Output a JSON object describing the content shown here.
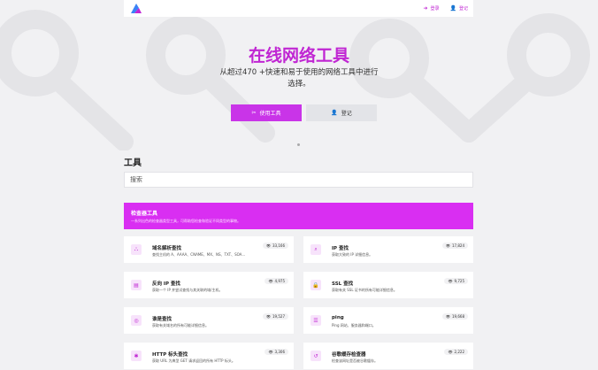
{
  "nav": {
    "login_label": "登录",
    "register_label": "登记"
  },
  "hero": {
    "title": "在线网络工具",
    "subtitle": "从超过470 +快速和易于使用的网络工具中进行选择。",
    "primary_button": "使用工具",
    "secondary_button": "登记"
  },
  "tools": {
    "heading": "工具",
    "search_placeholder": "搜索"
  },
  "category": {
    "title": "检查器工具",
    "description": "一系列出色的检查器类型工具，可帮助您检查和验证不同类型的事物。"
  },
  "cards": [
    {
      "title": "域名解析查找",
      "desc": "查找主机的 A、AAAA、CNAME、MX、NS、TXT、SOA...",
      "count": "33,166",
      "icon": "sitemap-icon"
    },
    {
      "title": "IP 查找",
      "desc": "获取大致的 IP 详细信息。",
      "count": "17,824",
      "icon": "search-location-icon"
    },
    {
      "title": "反向 IP 查找",
      "desc": "获取一个 IP 并尝试查找与其关联的域/主机。",
      "count": "4,975",
      "icon": "server-icon"
    },
    {
      "title": "SSL 查找",
      "desc": "获取有关 SSL 证书的所有可能详细信息。",
      "count": "9,725",
      "icon": "lock-icon"
    },
    {
      "title": "谁是查找",
      "desc": "获取有关域名的所有可能详细信息。",
      "count": "19,527",
      "icon": "globe-icon"
    },
    {
      "title": "ping",
      "desc": "Ping 网站、服务器和端口。",
      "count": "19,668",
      "icon": "server-stack-icon"
    },
    {
      "title": "HTTP 标头查找",
      "desc": "获取 URL 为典型 GET 请求返回的所有 HTTP 标头。",
      "count": "3,306",
      "icon": "asterisk-icon"
    },
    {
      "title": "谷歌缓存检查器",
      "desc": "检查该网址是否被谷歌缓存。",
      "count": "2,222",
      "icon": "history-icon"
    }
  ],
  "colors": {
    "accent": "#c026d3",
    "banner": "#d92ef2",
    "primary_button": "#c934e8"
  }
}
